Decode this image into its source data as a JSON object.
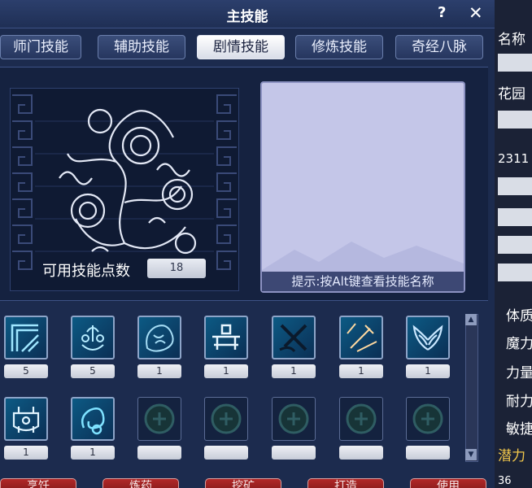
{
  "window": {
    "title": "主技能",
    "help_label": "?",
    "close_label": "✕"
  },
  "tabs": [
    {
      "label": "师门技能",
      "active": false
    },
    {
      "label": "辅助技能",
      "active": false
    },
    {
      "label": "剧情技能",
      "active": true
    },
    {
      "label": "修炼技能",
      "active": false
    },
    {
      "label": "奇经八脉",
      "active": false
    }
  ],
  "skill_points": {
    "label": "可用技能点数",
    "value": "18"
  },
  "hint": "提示:按Alt键查看技能名称",
  "skills_row1": [
    {
      "icon": "scroll-fold-icon",
      "level": "5"
    },
    {
      "icon": "herb-mortar-icon",
      "level": "5"
    },
    {
      "icon": "ore-rock-icon",
      "level": "1"
    },
    {
      "icon": "cooking-table-icon",
      "level": "1"
    },
    {
      "icon": "crossed-blades-icon",
      "level": "1"
    },
    {
      "icon": "forging-sword-icon",
      "level": "1"
    },
    {
      "icon": "wings-icon",
      "level": "1"
    }
  ],
  "skills_row2": [
    {
      "icon": "bronze-cauldron-icon",
      "level": "1",
      "filled": true
    },
    {
      "icon": "swirl-rune-icon",
      "level": "1",
      "filled": true
    },
    {
      "icon": "empty-slot-icon",
      "level": "",
      "filled": false
    },
    {
      "icon": "empty-slot-icon",
      "level": "",
      "filled": false
    },
    {
      "icon": "empty-slot-icon",
      "level": "",
      "filled": false
    },
    {
      "icon": "empty-slot-icon",
      "level": "",
      "filled": false
    },
    {
      "icon": "empty-slot-icon",
      "level": "",
      "filled": false
    }
  ],
  "bottom_buttons": [
    "烹饪",
    "炼药",
    "挖矿",
    "打造",
    "使用"
  ],
  "right_panel": {
    "name_label": "名称",
    "location": "花园",
    "number": "2311",
    "attributes": [
      "体质",
      "魔力",
      "力量",
      "耐力",
      "敏捷"
    ],
    "potential": "潜力",
    "bottom": "36"
  },
  "colors": {
    "accent_gold": "#f2c74b",
    "tab_active": "#ffffff",
    "desc_bg": "#c4c6e8"
  }
}
